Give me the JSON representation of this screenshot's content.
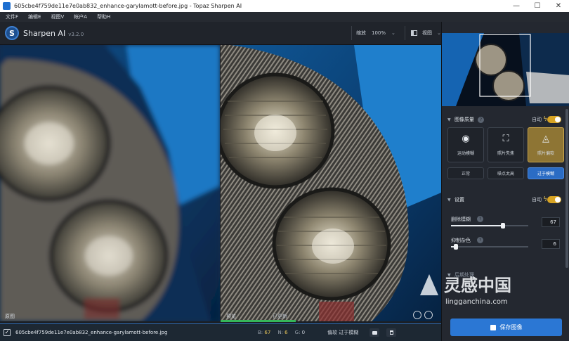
{
  "window": {
    "title": "605cbe4f759de11e7e0ab832_enhance-garylamott-before.jpg - Topaz Sharpen AI",
    "controls": [
      "—",
      "☐",
      "✕"
    ]
  },
  "menu": [
    "文件F",
    "编辑E",
    "视图V",
    "帐户A",
    "帮助H"
  ],
  "header": {
    "app_name": "Sharpen AI",
    "version": "v3.2.0",
    "zoom_label": "缩放",
    "zoom_value": "100%",
    "view_label": "视图"
  },
  "panes": {
    "left_label": "原图",
    "right_label": "预览",
    "right_status": "已更新",
    "progress": 0.34
  },
  "filebar": {
    "checked": true,
    "filename": "605cbe4f759de11e7e0ab832_enhance-garylamott-before.jpg",
    "stats": [
      {
        "key": "B:",
        "value": "67"
      },
      {
        "key": "N:",
        "value": "6"
      },
      {
        "key": "G:",
        "value": "0"
      }
    ],
    "mode_info": "偏软  过于模糊"
  },
  "sidebar": {
    "image_quality": {
      "title": "图像质量",
      "auto_label": "自动",
      "auto_on": true,
      "modes": [
        {
          "label": "运动模糊",
          "icon": "camera-shake-icon",
          "active": false
        },
        {
          "label": "照片失焦",
          "icon": "focus-person-icon",
          "active": false
        },
        {
          "label": "照片偏软",
          "icon": "water-drop-icon",
          "active": true
        }
      ],
      "levels": [
        {
          "label": "正常",
          "active": false
        },
        {
          "label": "噪点太高",
          "active": false
        },
        {
          "label": "过于模糊",
          "active": true
        }
      ]
    },
    "settings": {
      "title": "设置",
      "auto_label": "自动",
      "auto_on": true,
      "sliders": [
        {
          "label": "删除模糊",
          "value": "67",
          "level": 0.67
        },
        {
          "label": "抑制杂色",
          "value": "6",
          "level": 0.06
        }
      ]
    },
    "output_section": {
      "title": "后期处理"
    },
    "save_label": "保存图像"
  },
  "watermark": {
    "text_cn": "灵感中国",
    "text_url": "lingganchina.com"
  }
}
